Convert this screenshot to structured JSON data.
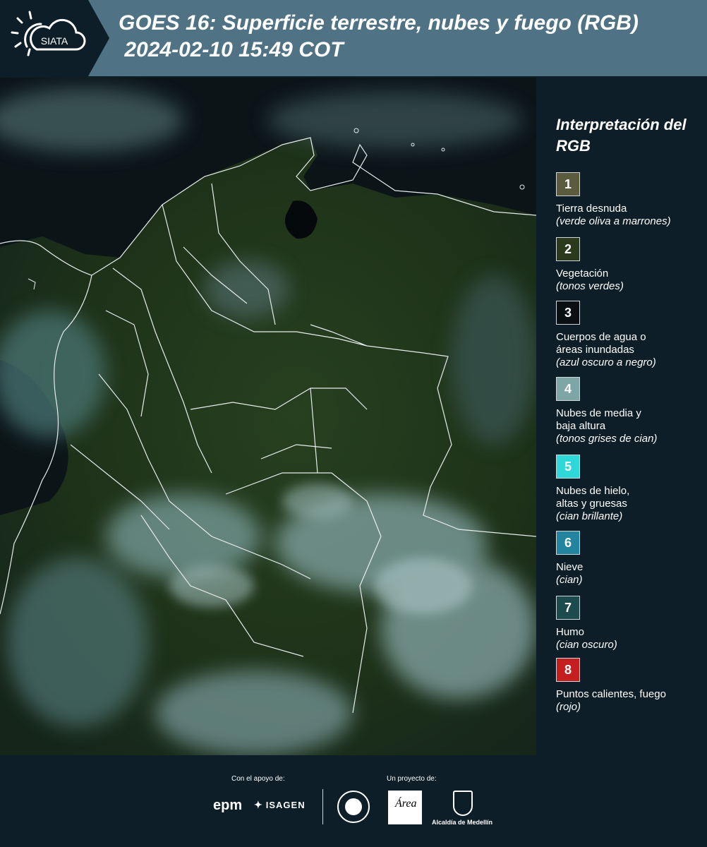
{
  "header": {
    "title_line1": "GOES 16: Superficie terrestre, nubes y fuego (RGB)",
    "title_line2": " 2024-02-10 15:49 COT",
    "logo_text": "SIATA",
    "bg_color": "#4f7385"
  },
  "legend": {
    "title": "Interpretación del RGB",
    "items": [
      {
        "num": "1",
        "label": "Tierra desnuda",
        "desc": "(verde oliva a marrones)",
        "color": "#5b5b3e"
      },
      {
        "num": "2",
        "label": "Vegetación",
        "desc": "(tonos verdes)",
        "color": "#2b3a1d"
      },
      {
        "num": "3",
        "label": "Cuerpos de agua o áreas inundadas",
        "desc": "(azul oscuro a negro)",
        "color": "#0a0f14"
      },
      {
        "num": "4",
        "label": "Nubes de media y baja altura",
        "desc": "(tonos grises de cian)",
        "color": "#7fa6a6"
      },
      {
        "num": "5",
        "label": "Nubes de hielo, altas y gruesas",
        "desc": "(cian brillante)",
        "color": "#2fd8d8"
      },
      {
        "num": "6",
        "label": "Nieve",
        "desc": "(cian)",
        "color": "#2384a0"
      },
      {
        "num": "7",
        "label": "Humo",
        "desc": "(cian oscuro)",
        "color": "#1d4a4c"
      },
      {
        "num": "8",
        "label": "Puntos calientes, fuego",
        "desc": "(rojo)",
        "color": "#c41e1e"
      }
    ]
  },
  "footer": {
    "support_label": "Con el apoyo de:",
    "project_label": "Un proyecto de:",
    "sponsors": {
      "epm": "epm",
      "isagen": "ISAGEN"
    },
    "partners": {
      "medellin": "Alcaldía de Medellín",
      "area": "Área"
    }
  }
}
